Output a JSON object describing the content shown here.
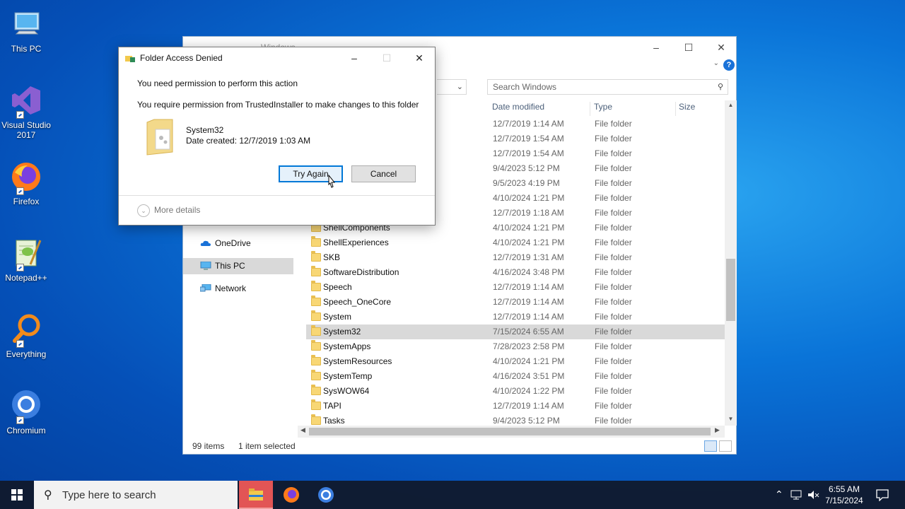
{
  "desktop": {
    "icons": [
      {
        "label": "This PC"
      },
      {
        "label": "Visual Studio 2017"
      },
      {
        "label": "Firefox"
      },
      {
        "label": "Notepad++"
      },
      {
        "label": "Everything"
      },
      {
        "label": "Chromium"
      }
    ]
  },
  "explorer": {
    "title": "Windows",
    "search_placeholder": "Search Windows",
    "columns": {
      "date": "Date modified",
      "type": "Type",
      "size": "Size"
    },
    "nav": [
      {
        "label": "OneDrive",
        "icon": "onedrive-icon"
      },
      {
        "label": "This PC",
        "icon": "this-pc-icon",
        "selected": true
      },
      {
        "label": "Network",
        "icon": "network-icon"
      }
    ],
    "hidden_rows": [
      {
        "date": "12/7/2019 1:14 AM",
        "type": "File folder"
      },
      {
        "date": "12/7/2019 1:54 AM",
        "type": "File folder"
      },
      {
        "date": "12/7/2019 1:54 AM",
        "type": "File folder"
      },
      {
        "date": "9/4/2023 5:12 PM",
        "type": "File folder"
      },
      {
        "date": "9/5/2023 4:19 PM",
        "type": "File folder"
      },
      {
        "date": "4/10/2024 1:21 PM",
        "type": "File folder"
      },
      {
        "date": "12/7/2019 1:18 AM",
        "type": "File folder"
      }
    ],
    "rows": [
      {
        "name": "ShellComponents",
        "date": "4/10/2024 1:21 PM",
        "type": "File folder"
      },
      {
        "name": "ShellExperiences",
        "date": "4/10/2024 1:21 PM",
        "type": "File folder"
      },
      {
        "name": "SKB",
        "date": "12/7/2019 1:31 AM",
        "type": "File folder"
      },
      {
        "name": "SoftwareDistribution",
        "date": "4/16/2024 3:48 PM",
        "type": "File folder"
      },
      {
        "name": "Speech",
        "date": "12/7/2019 1:14 AM",
        "type": "File folder"
      },
      {
        "name": "Speech_OneCore",
        "date": "12/7/2019 1:14 AM",
        "type": "File folder"
      },
      {
        "name": "System",
        "date": "12/7/2019 1:14 AM",
        "type": "File folder"
      },
      {
        "name": "System32",
        "date": "7/15/2024 6:55 AM",
        "type": "File folder",
        "selected": true
      },
      {
        "name": "SystemApps",
        "date": "7/28/2023 2:58 PM",
        "type": "File folder"
      },
      {
        "name": "SystemResources",
        "date": "4/10/2024 1:21 PM",
        "type": "File folder"
      },
      {
        "name": "SystemTemp",
        "date": "4/16/2024 3:51 PM",
        "type": "File folder"
      },
      {
        "name": "SysWOW64",
        "date": "4/10/2024 1:22 PM",
        "type": "File folder"
      },
      {
        "name": "TAPI",
        "date": "12/7/2019 1:14 AM",
        "type": "File folder"
      },
      {
        "name": "Tasks",
        "date": "9/4/2023 5:12 PM",
        "type": "File folder"
      }
    ],
    "status": {
      "count": "99 items",
      "selection": "1 item selected"
    }
  },
  "dialog": {
    "title": "Folder Access Denied",
    "heading": "You need permission to perform this action",
    "message": "You require permission from TrustedInstaller to make changes to this folder",
    "folder_name": "System32",
    "folder_date": "Date created: 12/7/2019 1:03 AM",
    "try_again": "Try Again",
    "cancel": "Cancel",
    "more_details": "More details"
  },
  "taskbar": {
    "search_placeholder": "Type here to search",
    "time": "6:55 AM",
    "date": "7/15/2024"
  },
  "colors": {
    "accent": "#0078d7",
    "selection": "#d9d9d9",
    "taskbar_active": "#e25555"
  }
}
